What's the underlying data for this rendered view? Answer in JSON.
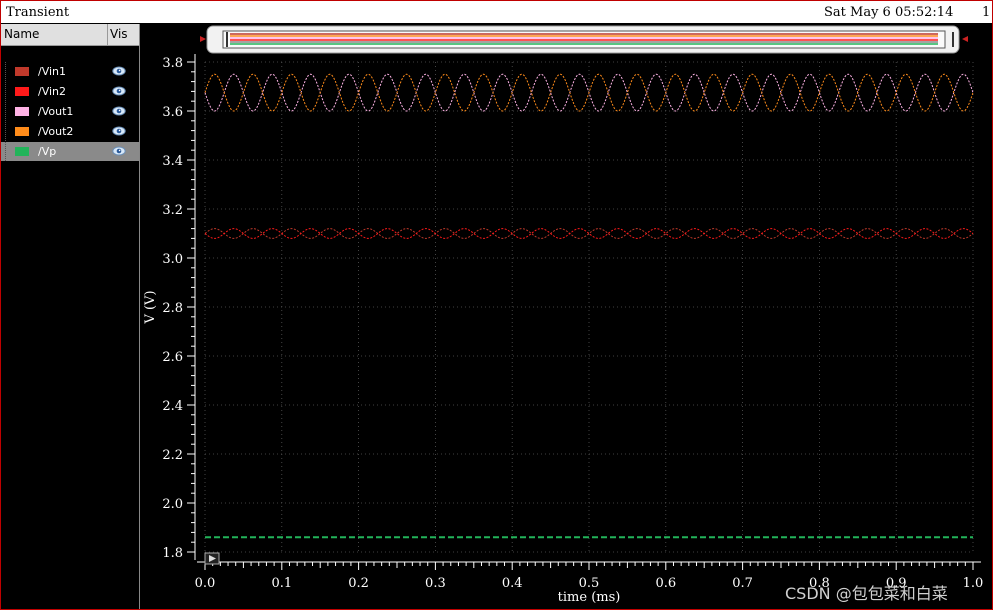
{
  "window": {
    "title": "Transient",
    "datetime": "Sat May 6 05:52:14",
    "number": "1"
  },
  "panel": {
    "col_name": "Name",
    "col_vis": "Vis",
    "signals": [
      {
        "label": "/Vin1",
        "color": "#c0392b",
        "selected": false
      },
      {
        "label": "/Vin2",
        "color": "#ff1a1a",
        "selected": false
      },
      {
        "label": "/Vout1",
        "color": "#ffb3e6",
        "selected": false
      },
      {
        "label": "/Vout2",
        "color": "#ff8c1a",
        "selected": false
      },
      {
        "label": "/Vp",
        "color": "#22b45a",
        "selected": true
      }
    ],
    "vis_icon": "eye-icon"
  },
  "scrollbar": {
    "icons": [
      "arrow-left-icon",
      "arrow-right-icon"
    ]
  },
  "watermark": "CSDN @包包菜和白菜",
  "chart_data": {
    "type": "line",
    "title": "",
    "xlabel": "time (ms)",
    "ylabel": "V (V)",
    "xlim": [
      0.0,
      1.0
    ],
    "ylim": [
      1.8,
      3.8
    ],
    "xticks": [
      "0.0",
      "0.1",
      "0.2",
      "0.3",
      "0.4",
      "0.5",
      "0.6",
      "0.7",
      "0.8",
      "0.9",
      "1.0"
    ],
    "yticks": [
      "1.8",
      "2.0",
      "2.2",
      "2.4",
      "2.6",
      "2.8",
      "3.0",
      "3.2",
      "3.4",
      "3.6",
      "3.8"
    ],
    "grid": true,
    "series": [
      {
        "name": "/Vin1",
        "color": "#c0392b",
        "kind": "sine",
        "offset": 3.1,
        "amplitude": 0.02,
        "frequency_khz": 20,
        "phase": 0
      },
      {
        "name": "/Vin2",
        "color": "#ff1a1a",
        "kind": "sine",
        "offset": 3.1,
        "amplitude": 0.02,
        "frequency_khz": 20,
        "phase": 180
      },
      {
        "name": "/Vout1",
        "color": "#ffb3e6",
        "kind": "sine",
        "offset": 3.675,
        "amplitude": 0.075,
        "frequency_khz": 20,
        "phase": 180
      },
      {
        "name": "/Vout2",
        "color": "#ff8c1a",
        "kind": "sine",
        "offset": 3.675,
        "amplitude": 0.075,
        "frequency_khz": 20,
        "phase": 0
      },
      {
        "name": "/Vp",
        "color": "#22b45a",
        "kind": "constant",
        "value": 1.86
      }
    ]
  }
}
